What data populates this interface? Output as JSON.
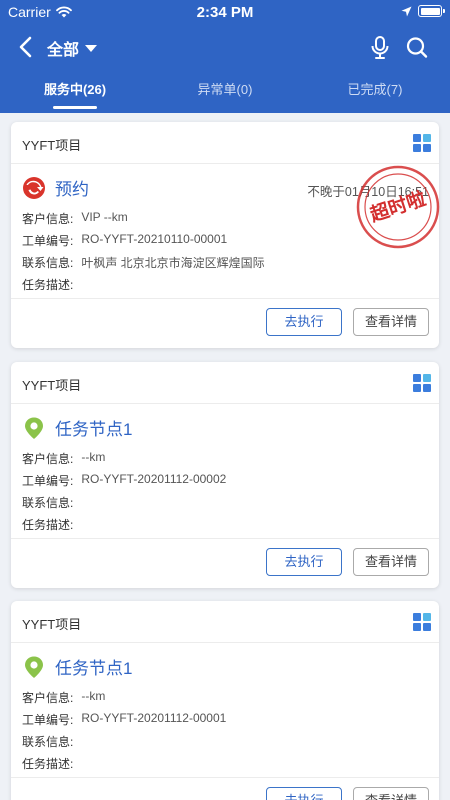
{
  "status": {
    "carrier": "Carrier",
    "time": "2:34 PM"
  },
  "nav": {
    "title": "全部"
  },
  "tabs": [
    {
      "label": "服务中(26)"
    },
    {
      "label": "异常单(0)"
    },
    {
      "label": "已完成(7)"
    }
  ],
  "labels": {
    "customer": "客户信息:",
    "order": "工单编号:",
    "contact": "联系信息:",
    "desc": "任务描述:",
    "execute": "去执行",
    "detail": "查看详情"
  },
  "cards": [
    {
      "project": "YYFT项目",
      "title": "预约",
      "deadline": "不晚于01月10日16:51",
      "customer": "VIP --km",
      "order_no": "RO-YYFT-20210110-00001",
      "contact": "叶枫声  北京北京市海淀区辉煌国际",
      "desc": "",
      "stamp": "超时啦"
    },
    {
      "project": "YYFT项目",
      "title": "任务节点1",
      "customer": "--km",
      "order_no": "RO-YYFT-20201112-00002",
      "contact": "",
      "desc": ""
    },
    {
      "project": "YYFT项目",
      "title": "任务节点1",
      "customer": "--km",
      "order_no": "RO-YYFT-20201112-00001",
      "contact": "",
      "desc": ""
    }
  ],
  "colors": {
    "primary": "#2f64c4",
    "stamp": "#d32f2f",
    "pin": "#8bc34a"
  }
}
